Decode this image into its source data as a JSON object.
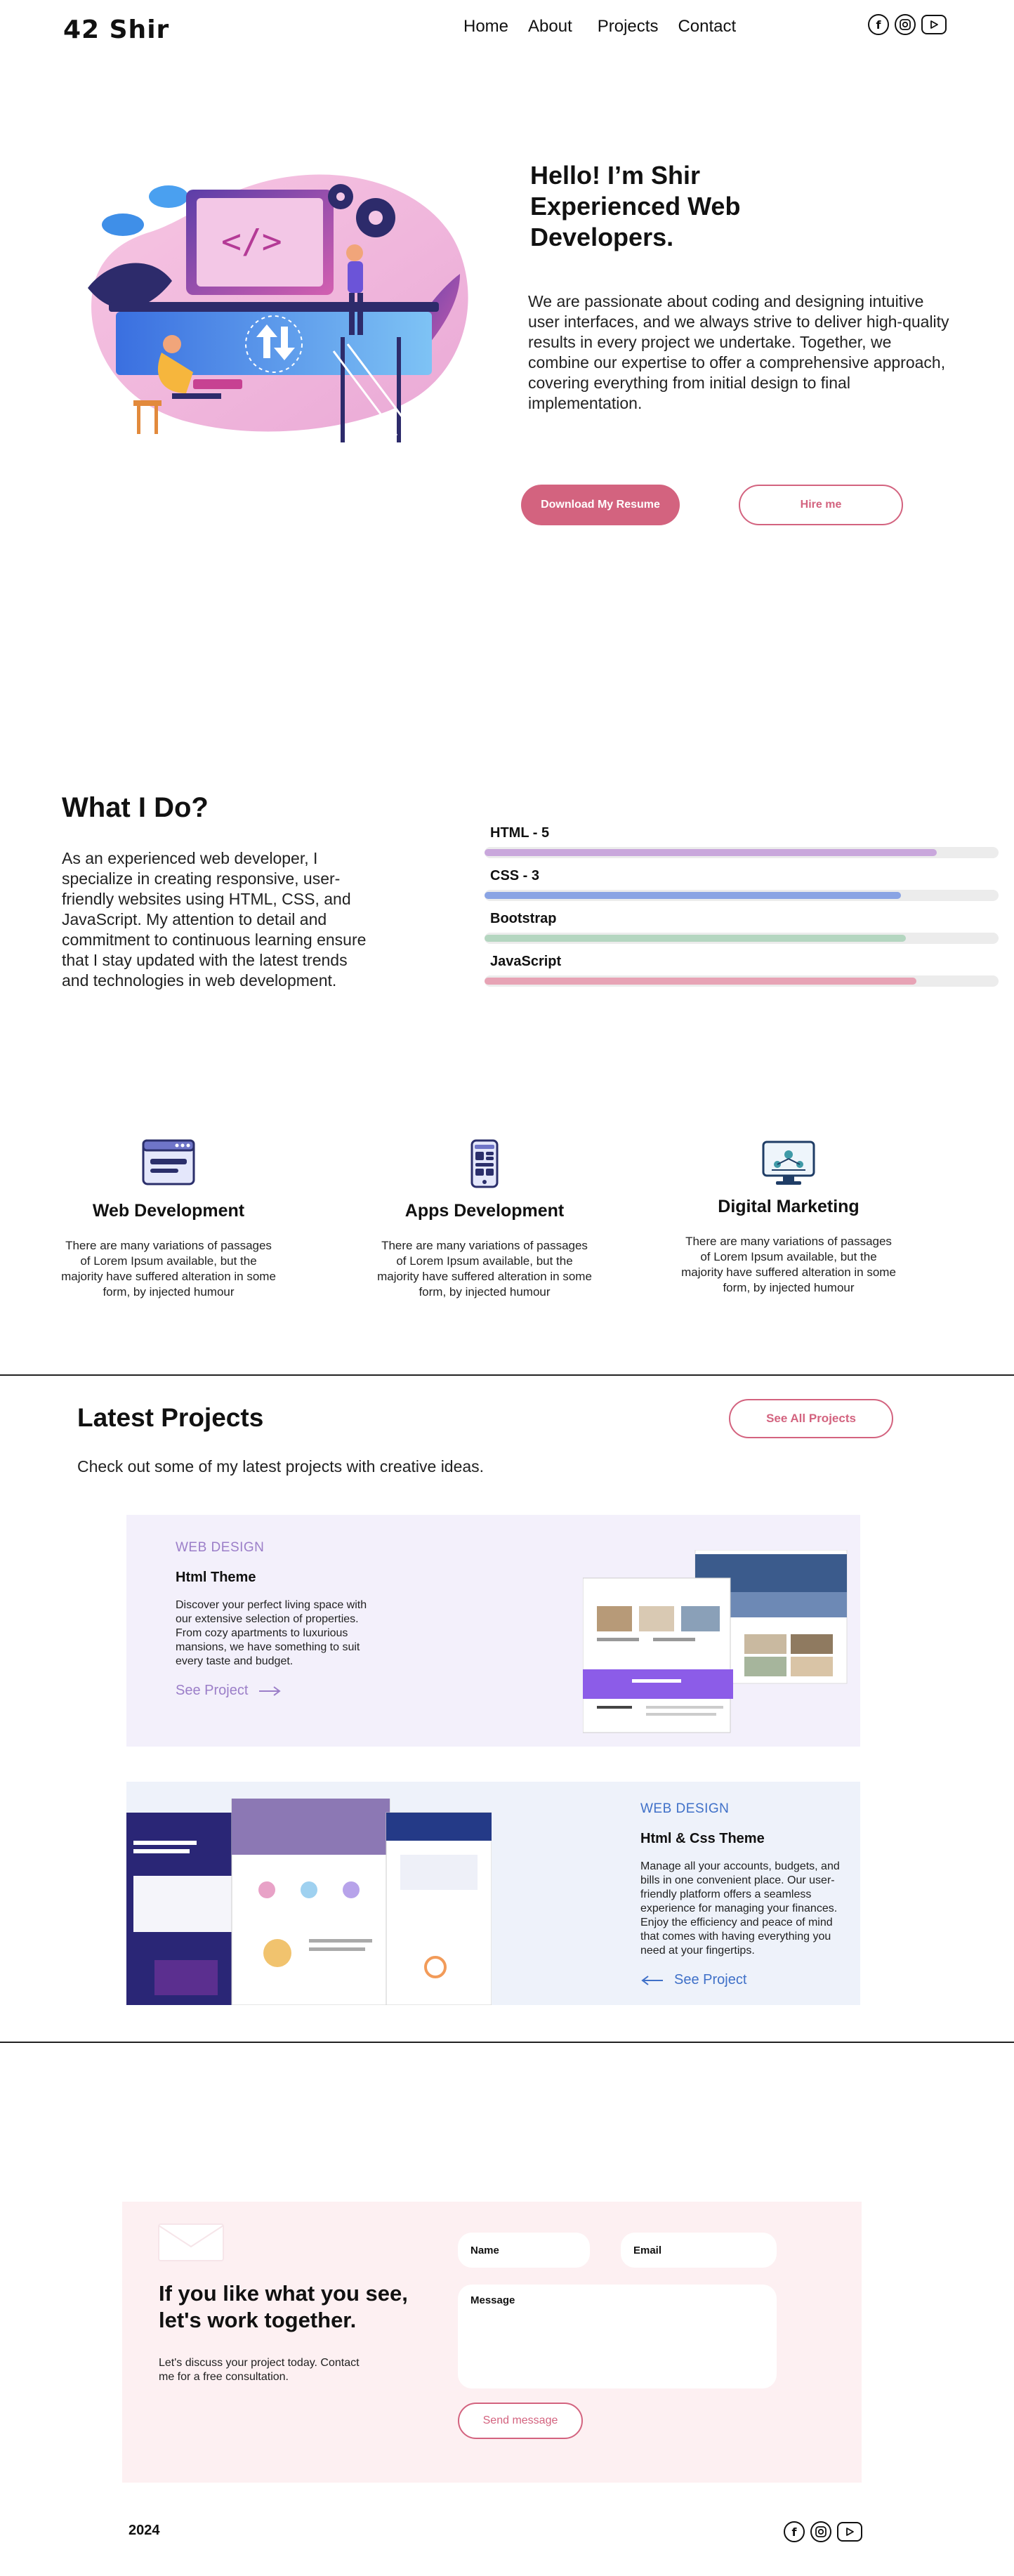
{
  "header": {
    "logo": "42 Shir",
    "nav": [
      "Home",
      "About",
      "Projects",
      "Contact"
    ],
    "socials": [
      "facebook-icon",
      "instagram-icon",
      "youtube-icon"
    ]
  },
  "hero": {
    "title": "Hello! I’m Shir Experienced Web Developers.",
    "text": "We are passionate about coding and designing intuitive user interfaces, and we always strive to deliver high-quality results in every project we undertake. Together, we combine our expertise to offer a comprehensive approach, covering everything from initial design to final implementation.",
    "resume_button": "Download My Resume",
    "hire_button": "Hire me"
  },
  "what_i_do": {
    "title": "What I Do?",
    "text": "As an experienced web developer, I specialize in creating responsive, user-friendly websites using HTML, CSS, and JavaScript. My attention to detail and commitment to continuous learning ensure that I stay updated with the latest trends and technologies in web development.",
    "skills": [
      {
        "label": "HTML - 5",
        "level": 0.88,
        "color": "#c9a7dc"
      },
      {
        "label": "CSS - 3",
        "level": 0.81,
        "color": "#8aa4e4"
      },
      {
        "label": "Bootstrap",
        "level": 0.82,
        "color": "#b4d6c0"
      },
      {
        "label": "JavaScript",
        "level": 0.84,
        "color": "#e7a3b5"
      }
    ]
  },
  "services": [
    {
      "title": "Web Development",
      "text": "There are many variations of passages of Lorem Ipsum available, but the majority have suffered alteration in some form, by injected humour"
    },
    {
      "title": "Apps Development",
      "text": "There are many variations of passages of Lorem Ipsum available, but the majority have suffered alteration in some form, by injected humour"
    },
    {
      "title": "Digital Marketing",
      "text": "There are many variations of passages of Lorem Ipsum available, but the majority have suffered alteration in some form, by injected humour"
    }
  ],
  "projects": {
    "title": "Latest Projects",
    "subtitle": "Check out some of my latest projects with creative ideas.",
    "see_all": "See All Projects",
    "items": [
      {
        "tag": "WEB DESIGN",
        "name": "Html  Theme",
        "desc": "Discover your perfect living space with our extensive selection of properties. From cozy apartments to luxurious mansions, we have something to suit every taste and budget.",
        "link": "See Project",
        "bg": "#f3f0fb",
        "accent": "#9b7ec8"
      },
      {
        "tag": "WEB DESIGN",
        "name": "Html & Css  Theme",
        "desc": "Manage all your accounts, budgets, and bills in one convenient place. Our user-friendly platform offers a seamless experience for managing your finances. Enjoy the efficiency and peace of mind that comes with having everything you need at your fingertips.",
        "link": "See Project",
        "bg": "#eef2fa",
        "accent": "#3f70c8"
      }
    ]
  },
  "contact": {
    "title": "If you like what you see, let's work together.",
    "subtitle": "Let's discuss your project today. Contact me for a free consultation.",
    "name_placeholder": "Name",
    "email_placeholder": "Email",
    "message_placeholder": "Message",
    "send_button": "Send message"
  },
  "footer": {
    "year": "2024"
  }
}
